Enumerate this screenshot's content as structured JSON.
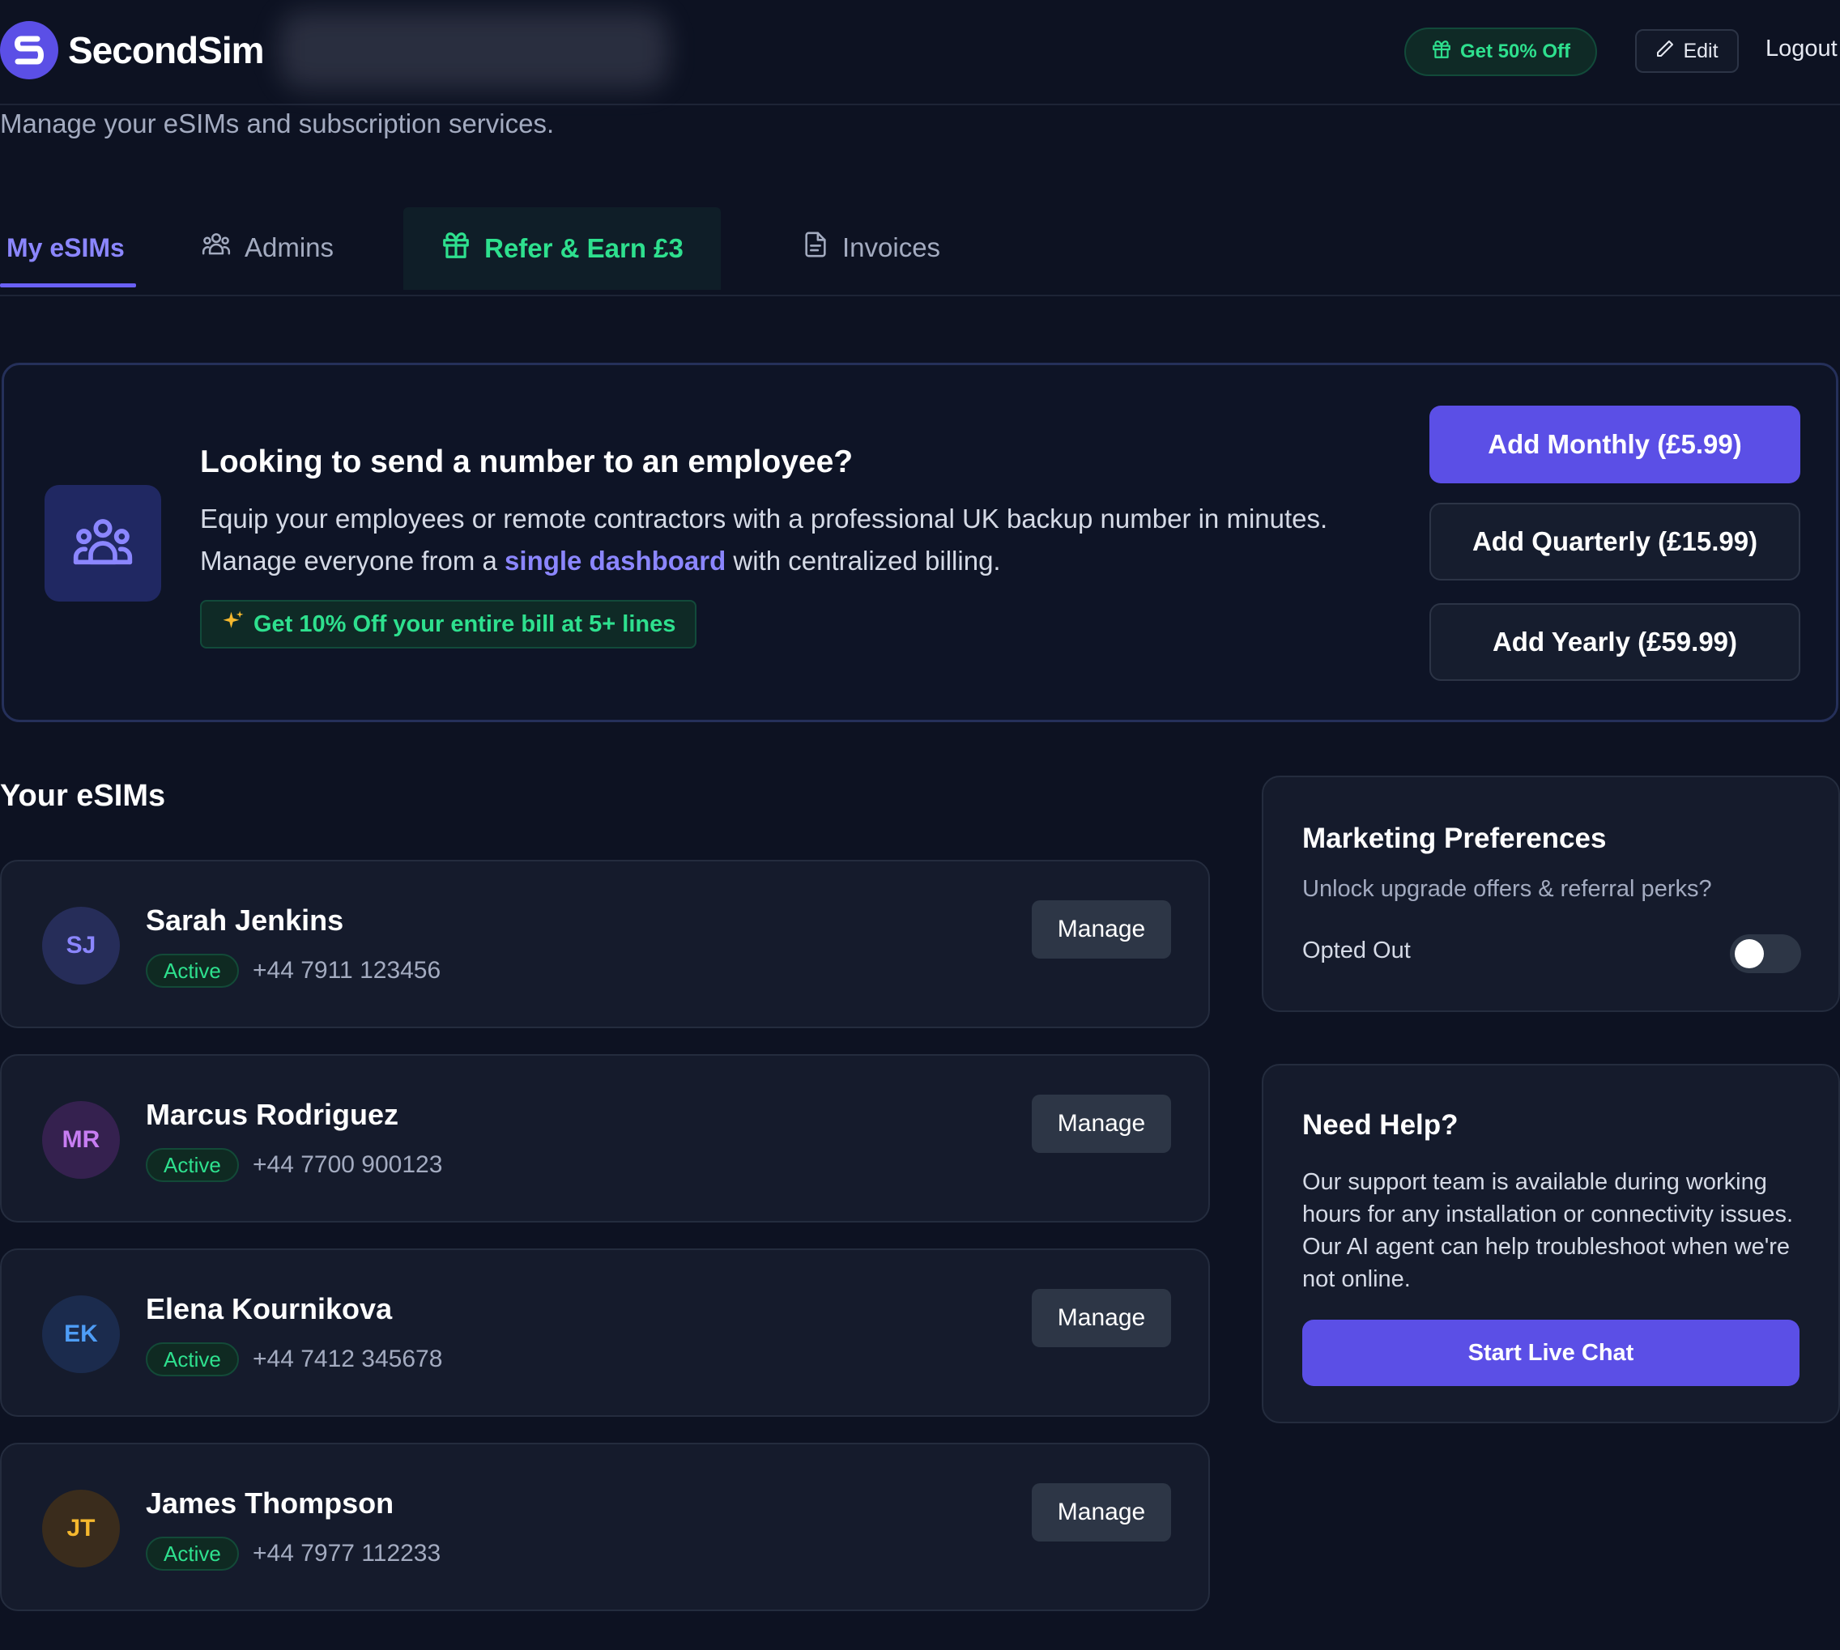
{
  "header": {
    "brand": "SecondSim",
    "offer_label": "Get 50% Off",
    "edit_label": "Edit",
    "logout_label": "Logout"
  },
  "subtitle": "Manage your eSIMs and subscription services.",
  "tabs": [
    {
      "label": "My eSIMs",
      "icon": "none",
      "active": true
    },
    {
      "label": "Admins",
      "icon": "users-icon",
      "active": false
    },
    {
      "label": "Refer & Earn £3",
      "icon": "gift-icon",
      "active": false
    },
    {
      "label": "Invoices",
      "icon": "document-icon",
      "active": false
    }
  ],
  "promo": {
    "title": "Looking to send a number to an employee?",
    "text_line1": "Equip your employees or remote contractors with a professional UK backup number in minutes.",
    "text_line2_before": "Manage everyone from a ",
    "text_link": "single dashboard",
    "text_line2_after": " with centralized billing.",
    "badge": "Get 10% Off your entire bill at 5+ lines",
    "buttons": {
      "monthly": "Add Monthly (£5.99)",
      "quarterly": "Add Quarterly (£15.99)",
      "yearly": "Add Yearly (£59.99)"
    }
  },
  "esims": {
    "title": "Your eSIMs",
    "manage_label": "Manage",
    "items": [
      {
        "initials": "SJ",
        "name": "Sarah Jenkins",
        "status": "Active",
        "phone": "+44 7911 123456"
      },
      {
        "initials": "MR",
        "name": "Marcus Rodriguez",
        "status": "Active",
        "phone": "+44 7700 900123"
      },
      {
        "initials": "EK",
        "name": "Elena Kournikova",
        "status": "Active",
        "phone": "+44 7412 345678"
      },
      {
        "initials": "JT",
        "name": "James Thompson",
        "status": "Active",
        "phone": "+44 7977 112233"
      }
    ]
  },
  "marketing": {
    "title": "Marketing Preferences",
    "description": "Unlock upgrade offers & referral perks?",
    "status": "Opted Out",
    "enabled": false
  },
  "help": {
    "title": "Need Help?",
    "text": "Our support team is available during working hours for any installation or connectivity issues. Our AI agent can help troubleshoot when we're not online.",
    "button": "Start Live Chat"
  },
  "colors": {
    "background": "#0d1222",
    "accent": "#5b4fe6",
    "success": "#2ee08e",
    "card": "#151b2c"
  }
}
